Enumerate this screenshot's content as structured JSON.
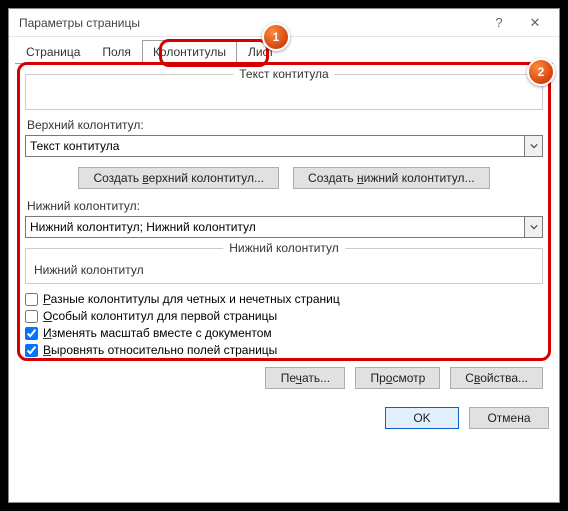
{
  "window": {
    "title": "Параметры страницы"
  },
  "tabs": {
    "items": [
      {
        "label": "Страница"
      },
      {
        "label": "Поля"
      },
      {
        "label": "Колонтитулы"
      },
      {
        "label": "Лист"
      }
    ]
  },
  "badges": {
    "b1": "1",
    "b2": "2"
  },
  "panel": {
    "top_fieldset_title": "Текст контитула",
    "upper_label": "Верхний колонтитул:",
    "upper_value": "Текст контитула",
    "create_upper_btn": "Создать верхний колонтитул...",
    "create_lower_btn": "Создать нижний колонтитул...",
    "create_upper_u": "в",
    "create_lower_u": "н",
    "lower_label": "Нижний колонтитул:",
    "lower_value": "Нижний колонтитул; Нижний колонтитул",
    "bottom_fieldset_title": "Нижний колонтитул",
    "bottom_fieldset_text": "Нижний колонтитул"
  },
  "checks": {
    "c1": "Разные колонтитулы для четных и нечетных страниц",
    "c2": "Особый колонтитул для первой страницы",
    "c3": "Изменять масштаб вместе с документом",
    "c4": "Выровнять относительно полей страницы",
    "c1_u": "Р",
    "c2_u": "О",
    "c3_u": "И",
    "c4_u": "В",
    "c1_checked": false,
    "c2_checked": false,
    "c3_checked": true,
    "c4_checked": true
  },
  "buttons": {
    "print": "Печать...",
    "print_u": "ч",
    "preview": "Просмотр",
    "preview_u": "о",
    "props": "Свойства...",
    "props_u": "в",
    "ok": "OK",
    "cancel": "Отмена"
  }
}
